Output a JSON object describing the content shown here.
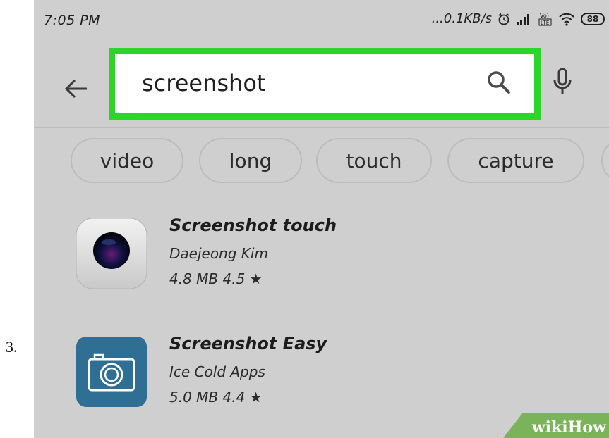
{
  "step_number": "3.",
  "status_bar": {
    "time": "7:05 PM",
    "net_speed": "...0.1KB/s",
    "battery": "88",
    "volte_label": "Vo) LTE"
  },
  "search": {
    "value": "screenshot"
  },
  "chips": [
    "video",
    "long",
    "touch",
    "capture"
  ],
  "apps": [
    {
      "title": "Screenshot touch",
      "developer": "Daejeong Kim",
      "meta": "4.8 MB  4.5 ★",
      "icon": "camera-lens-icon"
    },
    {
      "title": "Screenshot Easy",
      "developer": "Ice Cold Apps",
      "meta": "5.0 MB  4.4 ★",
      "icon": "camera-icon"
    }
  ],
  "watermark": "wikiHow",
  "colors": {
    "highlight": "#2bd629",
    "background": "#cfcfcf",
    "app2_icon": "#2f6f94"
  }
}
